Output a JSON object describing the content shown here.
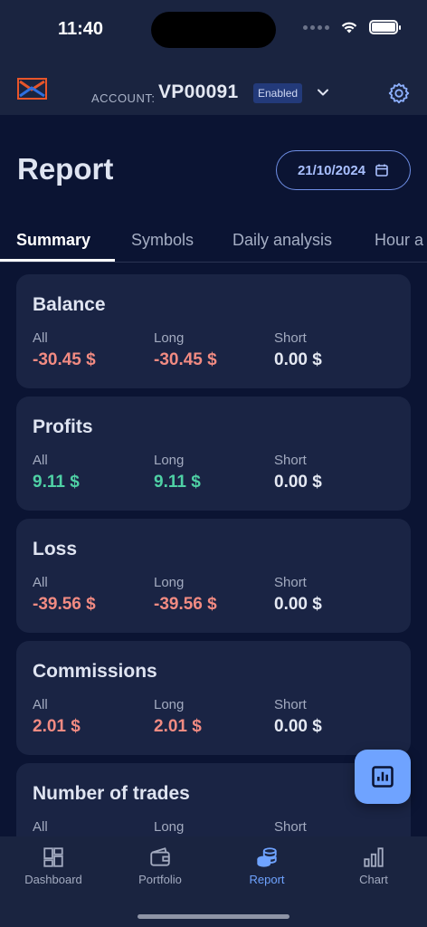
{
  "status_bar": {
    "time": "11:40"
  },
  "header": {
    "account_label": "ACCOUNT:",
    "account_id": "VP00091",
    "account_status": "Enabled"
  },
  "page": {
    "title": "Report",
    "date": "21/10/2024"
  },
  "tabs": [
    {
      "label": "Summary",
      "active": true
    },
    {
      "label": "Symbols",
      "active": false
    },
    {
      "label": "Daily analysis",
      "active": false
    },
    {
      "label": "Hour a",
      "active": false
    }
  ],
  "columns": {
    "all": "All",
    "long": "Long",
    "short": "Short"
  },
  "cards": [
    {
      "title": "Balance",
      "all": "-30.45 $",
      "long": "-30.45 $",
      "short": "0.00 $"
    },
    {
      "title": "Profits",
      "all": "9.11 $",
      "long": "9.11 $",
      "short": "0.00 $"
    },
    {
      "title": "Loss",
      "all": "-39.56 $",
      "long": "-39.56 $",
      "short": "0.00 $"
    },
    {
      "title": "Commissions",
      "all": "2.01 $",
      "long": "2.01 $",
      "short": "0.00 $"
    },
    {
      "title": "Number of trades"
    }
  ],
  "bottom_nav": [
    {
      "label": "Dashboard",
      "icon": "dashboard-icon"
    },
    {
      "label": "Portfolio",
      "icon": "wallet-icon"
    },
    {
      "label": "Report",
      "icon": "coins-icon",
      "active": true
    },
    {
      "label": "Chart",
      "icon": "bar-chart-icon"
    }
  ],
  "colors": {
    "background": "#0b1433",
    "card": "#1a2444",
    "accent": "#6fa3ff",
    "negative": "#f28b82",
    "positive": "#4fd1a5"
  }
}
